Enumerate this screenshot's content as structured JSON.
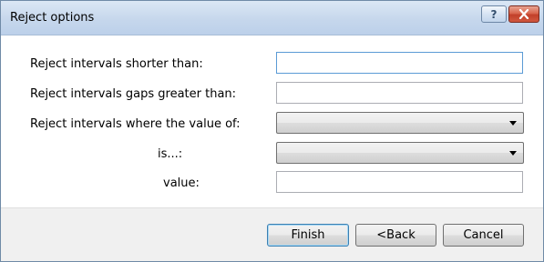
{
  "window": {
    "title": "Reject options"
  },
  "titlebar": {
    "help_glyph": "?",
    "close_icon": "close-icon",
    "help_icon": "help-icon"
  },
  "form": {
    "shorter_label": "Reject intervals shorter than:",
    "shorter_value": "",
    "gaps_label": "Reject intervals gaps greater than:",
    "gaps_value": "",
    "where_label": "Reject intervals where the value of:",
    "where_value": "",
    "is_label": "is...:",
    "is_value": "",
    "value_label": "value:",
    "value_value": ""
  },
  "buttons": {
    "finish": "Finish",
    "back": "<Back",
    "cancel": "Cancel"
  },
  "colors": {
    "title_gradient_top": "#dbe7f5",
    "close_red": "#c2402a",
    "default_button_border": "#3c7fb1"
  }
}
